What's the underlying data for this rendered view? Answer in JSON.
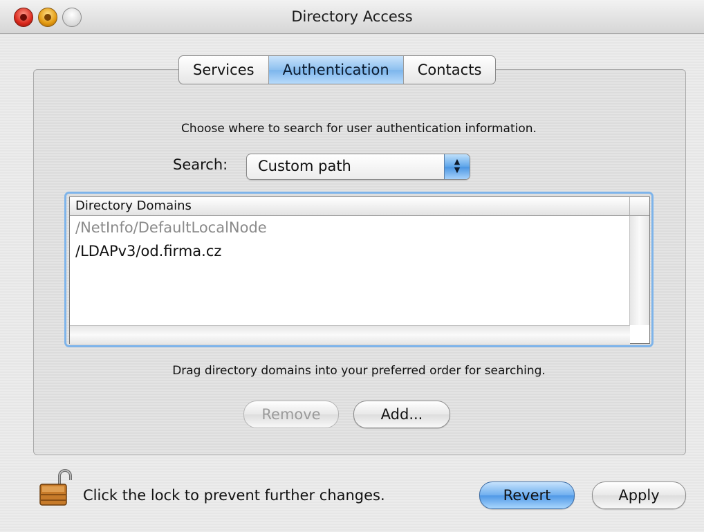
{
  "window": {
    "title": "Directory Access"
  },
  "tabs": [
    {
      "label": "Services",
      "selected": false
    },
    {
      "label": "Authentication",
      "selected": true
    },
    {
      "label": "Contacts",
      "selected": false
    }
  ],
  "panel": {
    "instruction": "Choose where to search for user authentication information.",
    "search_label": "Search:",
    "search_value": "Custom path",
    "table": {
      "column_header": "Directory Domains",
      "rows": [
        {
          "label": "/NetInfo/DefaultLocalNode",
          "enabled": false
        },
        {
          "label": "/LDAPv3/od.firma.cz",
          "enabled": true
        }
      ]
    },
    "hint": "Drag directory domains into your preferred order for searching.",
    "remove_label": "Remove",
    "add_label": "Add..."
  },
  "footer": {
    "lock_text": "Click the lock to prevent further changes.",
    "lock_icon": "unlocked-padlock-icon",
    "revert_label": "Revert",
    "apply_label": "Apply"
  },
  "colors": {
    "accent": "#5a9ee8",
    "disabled_text": "#8a8a8a"
  }
}
